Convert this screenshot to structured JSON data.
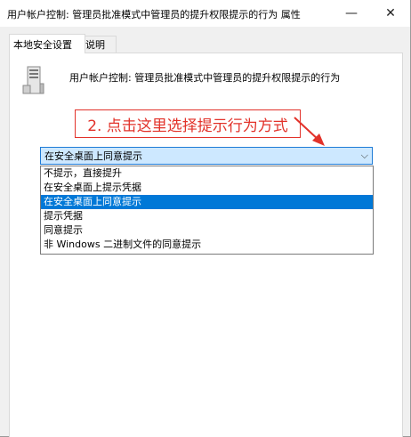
{
  "window": {
    "title": "用户帐户控制: 管理员批准模式中管理员的提升权限提示的行为 属性",
    "minimize_glyph": "—",
    "close_glyph": "✕"
  },
  "tabs": [
    {
      "label": "本地安全设置"
    },
    {
      "label": "说明"
    }
  ],
  "policy": {
    "icon": "server-icon",
    "name": "用户帐户控制: 管理员批准模式中管理员的提升权限提示的行为"
  },
  "annotation": {
    "text": "2. 点击这里选择提示行为方式",
    "color": "#e2322a"
  },
  "dropdown": {
    "value": "在安全桌面上同意提示",
    "chevron": "⌵",
    "options": [
      {
        "label": "不提示，直接提升"
      },
      {
        "label": "在安全桌面上提示凭据"
      },
      {
        "label": "在安全桌面上同意提示",
        "selected": true
      },
      {
        "label": "提示凭据"
      },
      {
        "label": "同意提示"
      },
      {
        "label": "非 Windows 二进制文件的同意提示"
      }
    ],
    "highlight_color": "#0078d7"
  }
}
